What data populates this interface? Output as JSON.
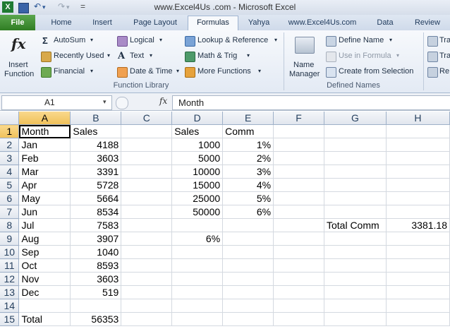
{
  "window": {
    "title": "www.Excel4Us .com  -  Microsoft Excel"
  },
  "quick_access": {
    "excel_icon": "X",
    "save_icon": "save-icon",
    "undo_glyph": "↶",
    "redo_glyph": "↷",
    "dropdown_glyph": "▾",
    "custom_glyph": "="
  },
  "tabs": [
    {
      "label": "File"
    },
    {
      "label": "Home"
    },
    {
      "label": "Insert"
    },
    {
      "label": "Page Layout"
    },
    {
      "label": "Formulas"
    },
    {
      "label": "Yahya"
    },
    {
      "label": "www.Excel4Us.com"
    },
    {
      "label": "Data"
    },
    {
      "label": "Review"
    }
  ],
  "ribbon": {
    "insert_function": {
      "glyph": "fx",
      "label1": "Insert",
      "label2": "Function"
    },
    "function_library": {
      "items": [
        "AutoSum",
        "Recently Used",
        "Financial",
        "Logical",
        "Text",
        "Date & Time",
        "Lookup & Reference",
        "Math & Trig",
        "More Functions"
      ],
      "label": "Function Library"
    },
    "defined_names": {
      "name_manager1": "Name",
      "name_manager2": "Manager",
      "define_name": "Define Name",
      "use_in_formula": "Use in Formula",
      "create_from_selection": "Create from Selection",
      "label": "Defined Names"
    },
    "audit": {
      "items": [
        "Tra",
        "Tra",
        "Re"
      ]
    }
  },
  "formula_bar": {
    "name_box": "A1",
    "fx": "fx",
    "content": "Month"
  },
  "sheet": {
    "columns": [
      "A",
      "B",
      "C",
      "D",
      "E",
      "F",
      "G",
      "H"
    ],
    "rows": [
      {
        "n": "1",
        "cells": [
          "Month",
          "Sales",
          "",
          "Sales",
          "Comm",
          "",
          "",
          ""
        ]
      },
      {
        "n": "2",
        "cells": [
          "Jan",
          "4188",
          "",
          "1000",
          "1%",
          "",
          "",
          ""
        ]
      },
      {
        "n": "3",
        "cells": [
          "Feb",
          "3603",
          "",
          "5000",
          "2%",
          "",
          "",
          ""
        ]
      },
      {
        "n": "4",
        "cells": [
          "Mar",
          "3391",
          "",
          "10000",
          "3%",
          "",
          "",
          ""
        ]
      },
      {
        "n": "5",
        "cells": [
          "Apr",
          "5728",
          "",
          "15000",
          "4%",
          "",
          "",
          ""
        ]
      },
      {
        "n": "6",
        "cells": [
          "May",
          "5664",
          "",
          "25000",
          "5%",
          "",
          "",
          ""
        ]
      },
      {
        "n": "7",
        "cells": [
          "Jun",
          "8534",
          "",
          "50000",
          "6%",
          "",
          "",
          ""
        ]
      },
      {
        "n": "8",
        "cells": [
          "Jul",
          "7583",
          "",
          "",
          "",
          "",
          "Total Comm",
          "3381.18"
        ]
      },
      {
        "n": "9",
        "cells": [
          "Aug",
          "3907",
          "",
          "6%",
          "",
          "",
          "",
          ""
        ]
      },
      {
        "n": "10",
        "cells": [
          "Sep",
          "1040",
          "",
          "",
          "",
          "",
          "",
          ""
        ]
      },
      {
        "n": "11",
        "cells": [
          "Oct",
          "8593",
          "",
          "",
          "",
          "",
          "",
          ""
        ]
      },
      {
        "n": "12",
        "cells": [
          "Nov",
          "3603",
          "",
          "",
          "",
          "",
          "",
          ""
        ]
      },
      {
        "n": "13",
        "cells": [
          "Dec",
          "519",
          "",
          "",
          "",
          "",
          "",
          ""
        ]
      },
      {
        "n": "14",
        "cells": [
          "",
          "",
          "",
          "",
          "",
          "",
          "",
          ""
        ]
      },
      {
        "n": "15",
        "cells": [
          "Total",
          "56353",
          "",
          "",
          "",
          "",
          "",
          ""
        ]
      }
    ]
  }
}
